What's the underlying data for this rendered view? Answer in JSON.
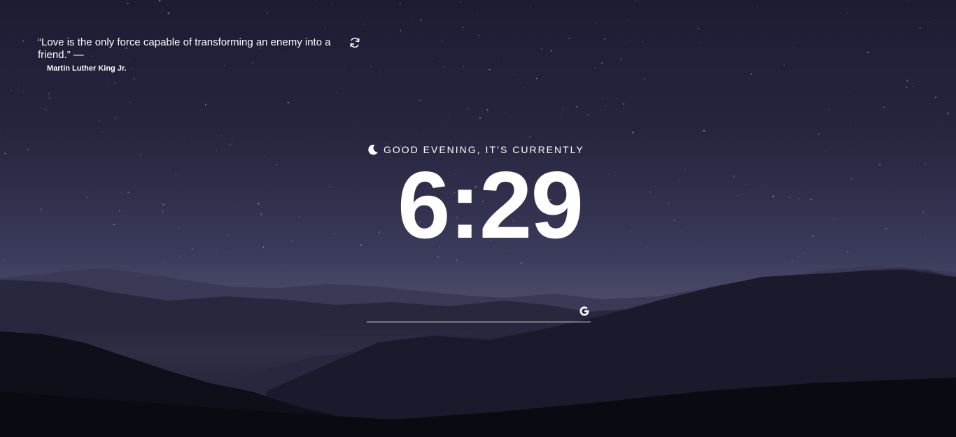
{
  "quote": {
    "text": "“Love is the only force capable of transforming an enemy into a friend.” —",
    "author": "Martin Luther King Jr."
  },
  "greeting": {
    "text": "GOOD EVENING, IT’S CURRENTLY",
    "icon": "moon-icon"
  },
  "clock": {
    "time": "6:29"
  },
  "search": {
    "value": "",
    "placeholder": "",
    "engine_icon": "google-icon"
  },
  "icons": {
    "refresh": "refresh-icon"
  },
  "colors": {
    "sky_top": "#1c1c33",
    "sky_mid": "#3a3a5a",
    "mountain_dark": "#0d0d18",
    "text": "#ffffff"
  }
}
